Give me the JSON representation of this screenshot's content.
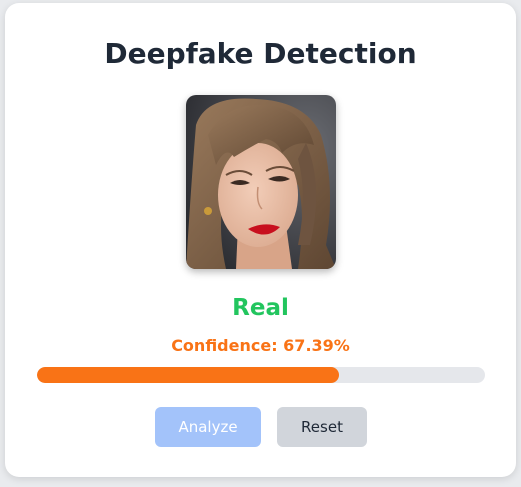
{
  "title": "Deepfake Detection",
  "image": {
    "alt": "portrait-photo"
  },
  "result": {
    "label": "Real",
    "confidence_text": "Confidence: 67.39%",
    "confidence_value": 0.6739
  },
  "buttons": {
    "analyze_label": "Analyze",
    "reset_label": "Reset"
  },
  "colors": {
    "title": "#1f2937",
    "verdict_real": "#22c55e",
    "confidence": "#f97316",
    "bar_fill": "#f97316",
    "bar_track": "#e5e7eb",
    "analyze_bg": "#a3c3fa",
    "reset_bg": "#d1d5db"
  }
}
